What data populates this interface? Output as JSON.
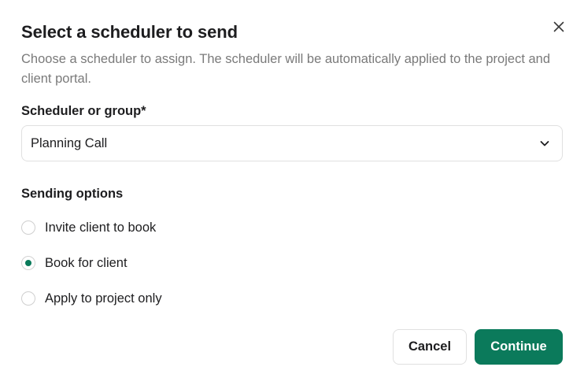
{
  "dialog": {
    "title": "Select a scheduler to send",
    "description": "Choose a scheduler to assign. The scheduler will be automatically applied to the project and client portal.",
    "close_icon": "close-icon"
  },
  "scheduler_field": {
    "label": "Scheduler or group*",
    "selected_value": "Planning Call",
    "icon": "chevron-down-icon"
  },
  "sending_options": {
    "label": "Sending options",
    "options": [
      {
        "label": "Invite client to book",
        "selected": false
      },
      {
        "label": "Book for client",
        "selected": true
      },
      {
        "label": "Apply to project only",
        "selected": false
      }
    ]
  },
  "actions": {
    "cancel_label": "Cancel",
    "continue_label": "Continue"
  },
  "colors": {
    "accent": "#0b7a5b",
    "description_text": "#7a7a7a",
    "border": "#e0e0e0"
  }
}
